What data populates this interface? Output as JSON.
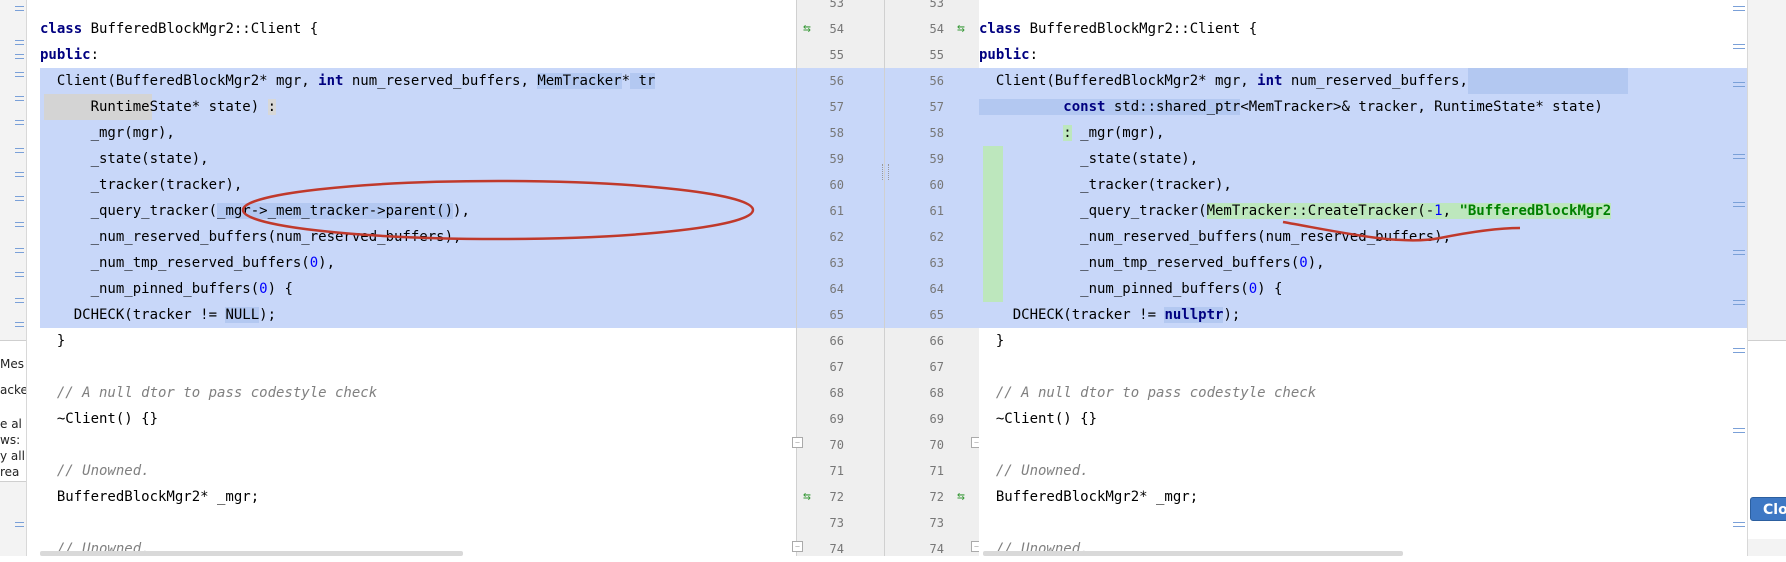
{
  "left_pane": {
    "lines": [
      {
        "t": "class BufferedBlockMgr2::Client {"
      },
      {
        "t": "public:"
      },
      {
        "t": "  Client(BufferedBlockMgr2* mgr, int num_reserved_buffers, MemTracker* tr"
      },
      {
        "t": "      RuntimeState* state) :"
      },
      {
        "t": "      _mgr(mgr),"
      },
      {
        "t": "      _state(state),"
      },
      {
        "t": "      _tracker(tracker),"
      },
      {
        "t": "      _query_tracker(_mgr->_mem_tracker->parent()),"
      },
      {
        "t": "      _num_reserved_buffers(num_reserved_buffers),"
      },
      {
        "t": "      _num_tmp_reserved_buffers(0),"
      },
      {
        "t": "      _num_pinned_buffers(0) {"
      },
      {
        "t": "    DCHECK(tracker != NULL);"
      },
      {
        "t": "  }"
      },
      {
        "t": ""
      },
      {
        "t": "  // A null dtor to pass codestyle check"
      },
      {
        "t": "  ~Client() {}"
      },
      {
        "t": ""
      },
      {
        "t": "  // Unowned."
      },
      {
        "t": "  BufferedBlockMgr2* _mgr;"
      },
      {
        "t": ""
      },
      {
        "t": "  // Unowned."
      }
    ],
    "seg": {
      "l0_kw": "class",
      "l0_rest": " BufferedBlockMgr2::Client {",
      "l1_kw": "public",
      "l2_a": "  Client(BufferedBlockMgr2* mgr, ",
      "l2_kw": "int",
      "l2_b": " num_reserved_buffers, ",
      "l2_c": "MemTracker",
      "l2_d": "*",
      "l2_e": " tr",
      "l3_a": "      RuntimeState* state) ",
      "l3_b": ":",
      "l4": "      _mgr(mgr),",
      "l5": "      _state(state),",
      "l6": "      _tracker(tracker),",
      "l7_a": "      _query_tracker(",
      "l7_b": "_mgr->_mem_tracker->parent()",
      "l7_c": "),",
      "l8": "      _num_reserved_buffers(num_reserved_buffers),",
      "l9_a": "      _num_tmp_reserved_buffers(",
      "l9_n": "0",
      "l9_b": "),",
      "l10_a": "      _num_pinned_buffers(",
      "l10_n": "0",
      "l10_b": ") {",
      "l11_a": "    DCHECK(tracker != ",
      "l11_b": "NULL",
      "l11_c": ");",
      "l12": "  }",
      "l14": "  // A null dtor to pass codestyle check",
      "l15": "  ~Client() {}",
      "l17": "  // Unowned.",
      "l18": "  BufferedBlockMgr2* _mgr;",
      "l20": "  // Unowned."
    }
  },
  "right_pane": {
    "seg": {
      "l0_kw": "class",
      "l0_rest": " BufferedBlockMgr2::Client {",
      "l1_kw": "public",
      "l2_a": "  Client(BufferedBlockMgr2* mgr, ",
      "l2_kw": "int",
      "l2_b": " num_reserved_buffers,",
      "l3_a": "          ",
      "l3_kw": "const",
      "l3_b": " std::shared_ptr",
      "l3_c": "<MemTracker>&",
      "l3_d": " tracker, RuntimeState* state)",
      "l4_a": "          ",
      "l4_b": ":",
      "l4_c": " _mgr(mgr),",
      "l5": "            _state(state),",
      "l6": "            _tracker(tracker),",
      "l7_a": "            _query_tracker(",
      "l7_b": "MemTracker::CreateTracker(-",
      "l7_n": "1",
      "l7_c": ", ",
      "l7_s": "\"BufferedBlockMgr2",
      "l8": "            _num_reserved_buffers(num_reserved_buffers),",
      "l9_a": "            _num_tmp_reserved_buffers(",
      "l9_n": "0",
      "l9_b": "),",
      "l10_a": "            _num_pinned_buffers(",
      "l10_n": "0",
      "l10_b": ") {",
      "l11_a": "    DCHECK(tracker != ",
      "l11_b": "nullptr",
      "l11_c": ");",
      "l12": "  }",
      "l14": "  // A null dtor to pass codestyle check",
      "l15": "  ~Client() {}",
      "l17": "  // Unowned.",
      "l18": "  BufferedBlockMgr2* _mgr;",
      "l20": "  // Unowned."
    }
  },
  "gutter": {
    "line_numbers": [
      "53",
      "54",
      "55",
      "56",
      "57",
      "58",
      "59",
      "60",
      "61",
      "62",
      "63",
      "64",
      "65",
      "66",
      "67",
      "68",
      "69",
      "70",
      "71",
      "72",
      "73",
      "74"
    ]
  },
  "background_window": {
    "left_fragments": [
      "Mes",
      "acke",
      "e al",
      "ws:",
      "y all",
      "rea"
    ],
    "close_label": "Clo"
  },
  "colors": {
    "changed_line": "#c8d7f9",
    "added_block": "#bde7bd",
    "annotation": "#c0392b"
  }
}
